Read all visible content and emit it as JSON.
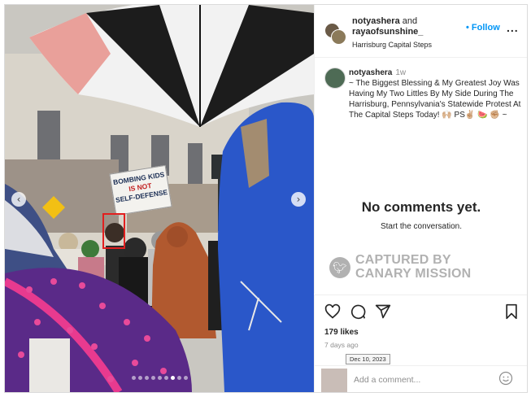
{
  "post": {
    "header": {
      "user1": "notyashera",
      "connector": "and",
      "user2": "rayaofsunshine_",
      "location": "Harrisburg Capital Steps",
      "follow_label": "Follow",
      "more_label": "..."
    },
    "caption": {
      "username": "notyashera",
      "age": "1w",
      "text": "~ The Biggest Blessing & My Greatest Joy Was Having My Two Littles By My Side During The Harrisburg, Pennsylvania's Statewide Protest At The Capital Steps Today! 🙌🏼 PS✌🏼 🍉 ✊🏼 ~"
    },
    "comments": {
      "empty_title": "No comments yet.",
      "empty_subtitle": "Start the conversation."
    },
    "watermark": {
      "line1": "CAPTURED BY",
      "line2": "CANARY MISSION",
      "icon": "canary-bird-icon"
    },
    "engagement": {
      "likes": "179 likes",
      "posted_ago": "7 days ago",
      "date_tooltip": "Dec 10, 2023"
    },
    "comment_box": {
      "placeholder": "Add a comment..."
    },
    "photo": {
      "sign_line1": "BOMBING KIDS",
      "sign_line2": "IS NOT",
      "sign_line3": "SELF-DEFENSE",
      "prev_icon": "chevron-left-icon",
      "next_icon": "chevron-right-icon",
      "slide_count": 9,
      "active_slide": 7
    },
    "colors": {
      "follow": "#0095f6",
      "highlight_box": "#e21f1f",
      "text": "#262626",
      "muted": "#8e8e8e"
    }
  }
}
